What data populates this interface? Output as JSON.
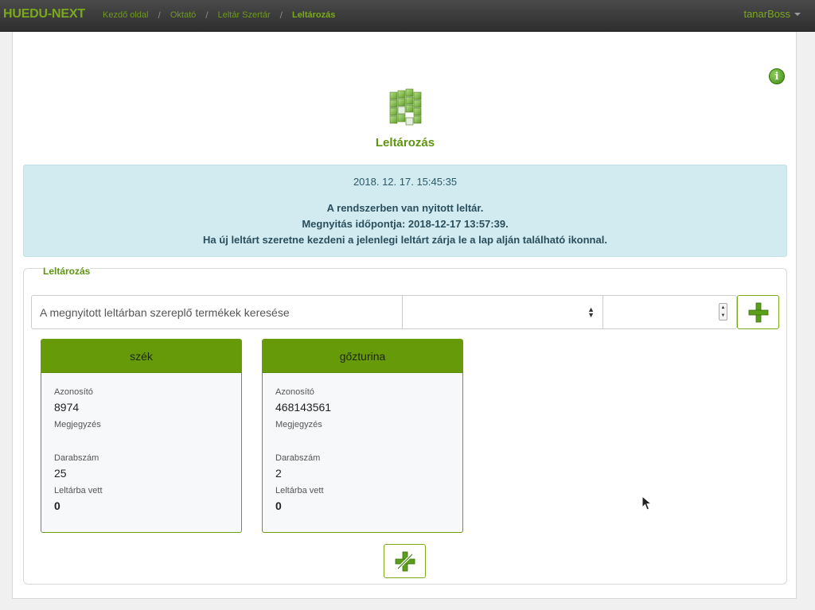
{
  "navbar": {
    "brand": "HUEDU-NEXT",
    "breadcrumbs": [
      "Kezdő oldal",
      "Oktató",
      "Leltár Szertár",
      "Leltározás"
    ],
    "user": "tanarBoss"
  },
  "page": {
    "title": "Leltározás",
    "icons": {
      "info": "info-icon",
      "app": "inventory-grid-icon"
    }
  },
  "alert": {
    "datetime": "2018. 12. 17. 15:45:35",
    "line1": "A rendszerben van nyitott leltár.",
    "line2": "Megnyitás időpontja: 2018-12-17 13:57:39.",
    "line3": "Ha új leltárt szeretne kezdeni a jelenlegi leltárt zárja le a lap alján található ikonnal."
  },
  "section": {
    "legend": "Leltározás",
    "search_placeholder": "A megnyitott leltárban szereplő termékek keresése",
    "select_value": "",
    "quantity_value": ""
  },
  "labels": {
    "id": "Azonosító",
    "note": "Megjegyzés",
    "count": "Darabszám",
    "inventoried": "Leltárba vett"
  },
  "cards": [
    {
      "name": "szék",
      "id": "8974",
      "note": "",
      "count": "25",
      "inventoried": "0"
    },
    {
      "name": "gőzturina",
      "id": "468143561",
      "note": "",
      "count": "2",
      "inventoried": "0"
    }
  ],
  "colors": {
    "accent": "#679a08",
    "brand": "#7aaa1c",
    "alert_bg": "#d2ebf0"
  }
}
